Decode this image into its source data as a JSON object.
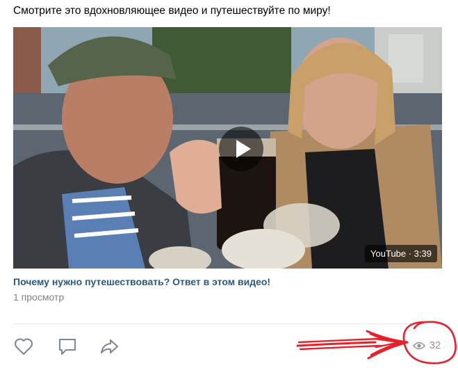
{
  "post": {
    "text": "Смотрите это вдохновляющее видео и путешествуйте по миру!"
  },
  "video": {
    "duration_badge": "YouTube · 3:39",
    "title": "Почему нужно путешествовать? Ответ в этом видео!",
    "views": "1 просмотр"
  },
  "actions": {
    "like_icon": "heart-icon",
    "comment_icon": "comment-icon",
    "share_icon": "share-arrow-icon",
    "views_icon": "eye-icon",
    "views_count": "32"
  },
  "colors": {
    "link": "#2a5885",
    "muted": "#828282",
    "icon": "#7f8792",
    "annotation_red": "#e8202a"
  }
}
